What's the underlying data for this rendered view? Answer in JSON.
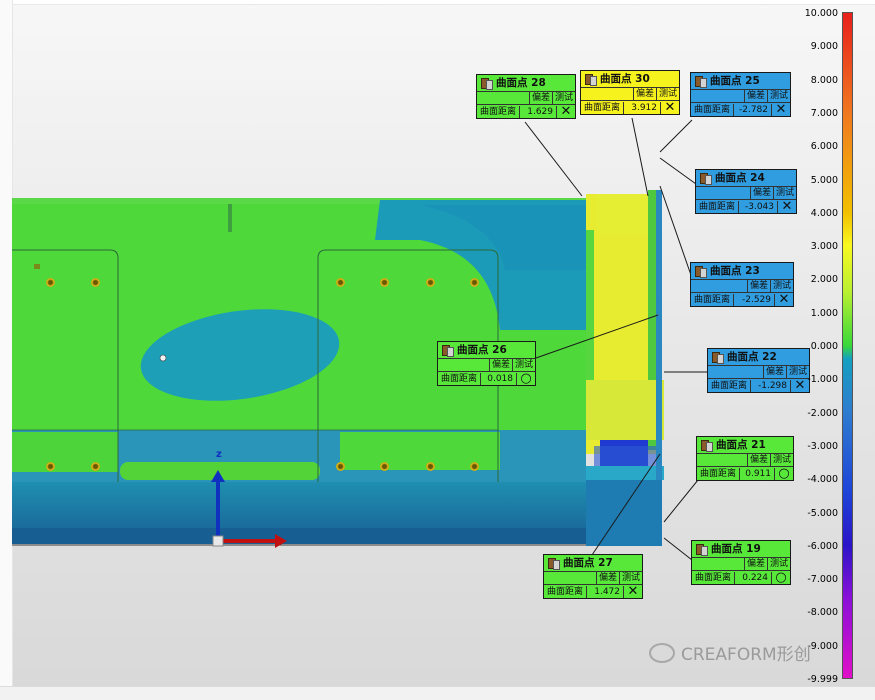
{
  "scale": {
    "ticks": [
      "10.000",
      "9.000",
      "8.000",
      "7.000",
      "6.000",
      "5.000",
      "4.000",
      "3.000",
      "2.000",
      "1.000",
      "0.000",
      "-1.000",
      "-2.000",
      "-3.000",
      "-4.000",
      "-5.000",
      "-6.000",
      "-7.000",
      "-8.000",
      "-9.000",
      "-9.999"
    ]
  },
  "axis": {
    "z_label": "z"
  },
  "callouts": [
    {
      "title": "曲面点 28",
      "col1": "偏差",
      "col2": "测试",
      "row_label": "曲面距离",
      "value": "1.629",
      "status": "✕",
      "color": "#57e83a"
    },
    {
      "title": "曲面点 30",
      "col1": "偏差",
      "col2": "测试",
      "row_label": "曲面距离",
      "value": "3.912",
      "status": "✕",
      "color": "#f6f21e"
    },
    {
      "title": "曲面点 25",
      "col1": "偏差",
      "col2": "测试",
      "row_label": "曲面距离",
      "value": "-2.782",
      "status": "✕",
      "color": "#2f9de0"
    },
    {
      "title": "曲面点 24",
      "col1": "偏差",
      "col2": "测试",
      "row_label": "曲面距离",
      "value": "-3.043",
      "status": "✕",
      "color": "#2f9de0"
    },
    {
      "title": "曲面点 23",
      "col1": "偏差",
      "col2": "测试",
      "row_label": "曲面距离",
      "value": "-2.529",
      "status": "✕",
      "color": "#2f9de0"
    },
    {
      "title": "曲面点 26",
      "col1": "偏差",
      "col2": "测试",
      "row_label": "曲面距离",
      "value": "0.018",
      "status": "○",
      "color": "#57e83a"
    },
    {
      "title": "曲面点 22",
      "col1": "偏差",
      "col2": "测试",
      "row_label": "曲面距离",
      "value": "-1.298",
      "status": "✕",
      "color": "#2f9de0"
    },
    {
      "title": "曲面点 21",
      "col1": "偏差",
      "col2": "测试",
      "row_label": "曲面距离",
      "value": "0.911",
      "status": "○",
      "color": "#57e83a"
    },
    {
      "title": "曲面点 27",
      "col1": "偏差",
      "col2": "测试",
      "row_label": "曲面距离",
      "value": "1.472",
      "status": "✕",
      "color": "#57e83a"
    },
    {
      "title": "曲面点 19",
      "col1": "偏差",
      "col2": "测试",
      "row_label": "曲面距离",
      "value": "0.224",
      "status": "○",
      "color": "#57e83a"
    }
  ],
  "watermark": {
    "text": "CREAFORM形创"
  }
}
